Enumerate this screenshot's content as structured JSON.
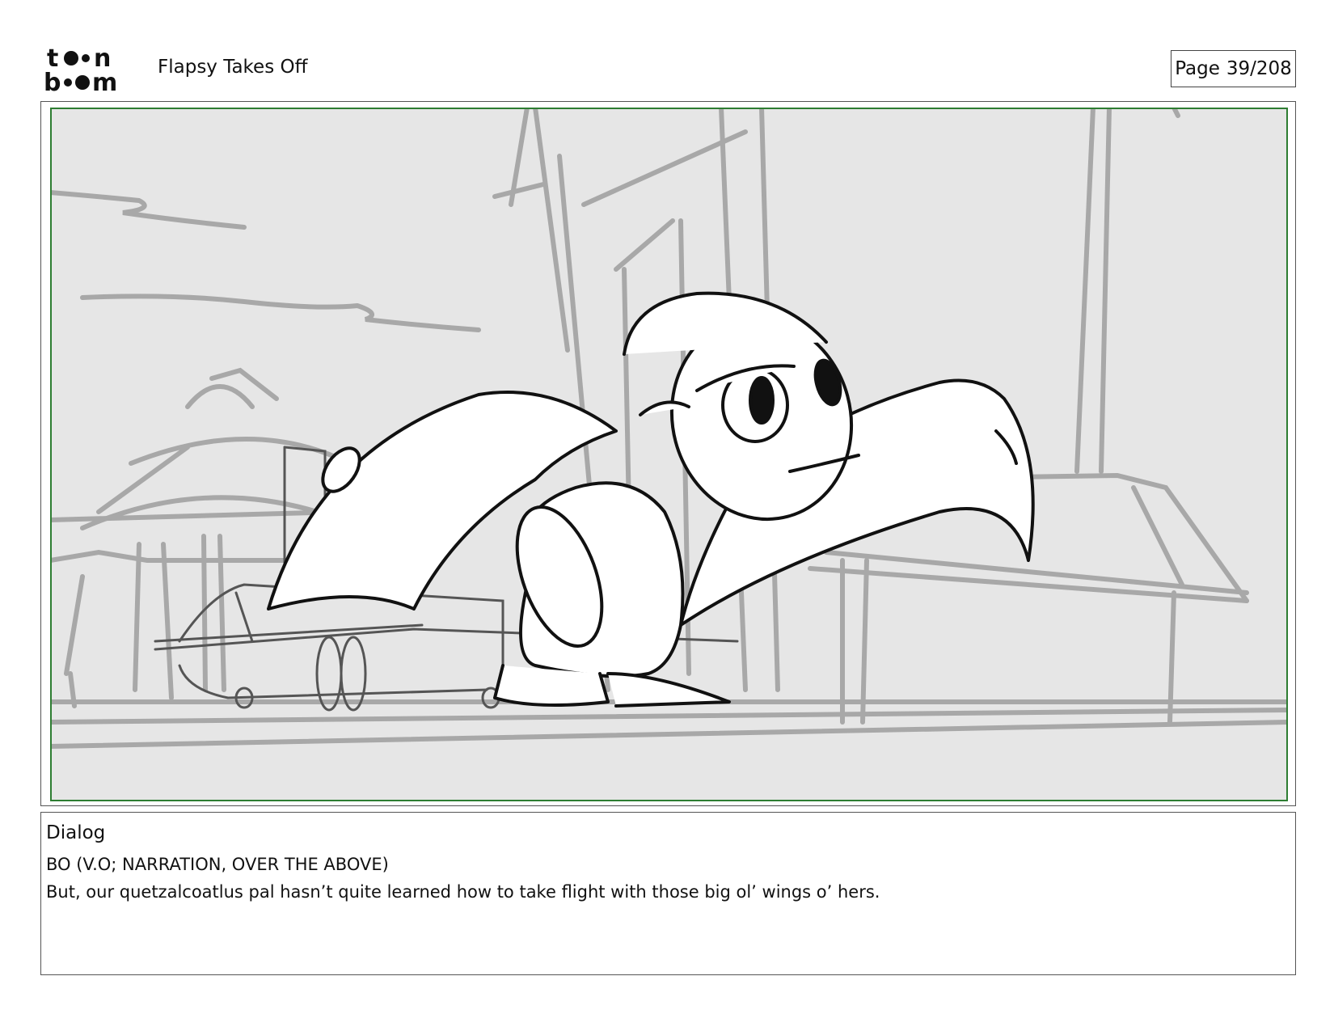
{
  "header": {
    "logo_text": "toon boom",
    "project_title": "Flapsy Takes Off",
    "page_label": "Page",
    "page_number": "39/208"
  },
  "panel": {
    "image_description_icon": "storyboard-sketch-icon"
  },
  "dialog": {
    "heading": "Dialog",
    "speaker": "BO (V.O; NARRATION, OVER THE ABOVE)",
    "line": "But, our quetzalcoatlus pal hasn’t quite learned how to take flight with those big ol’ wings o’ hers."
  },
  "colors": {
    "safe_frame": "#2e7d32",
    "sketch_bg": "#e6e6e6",
    "sketch_gray": "#a8a8a8",
    "ink": "#111111"
  }
}
